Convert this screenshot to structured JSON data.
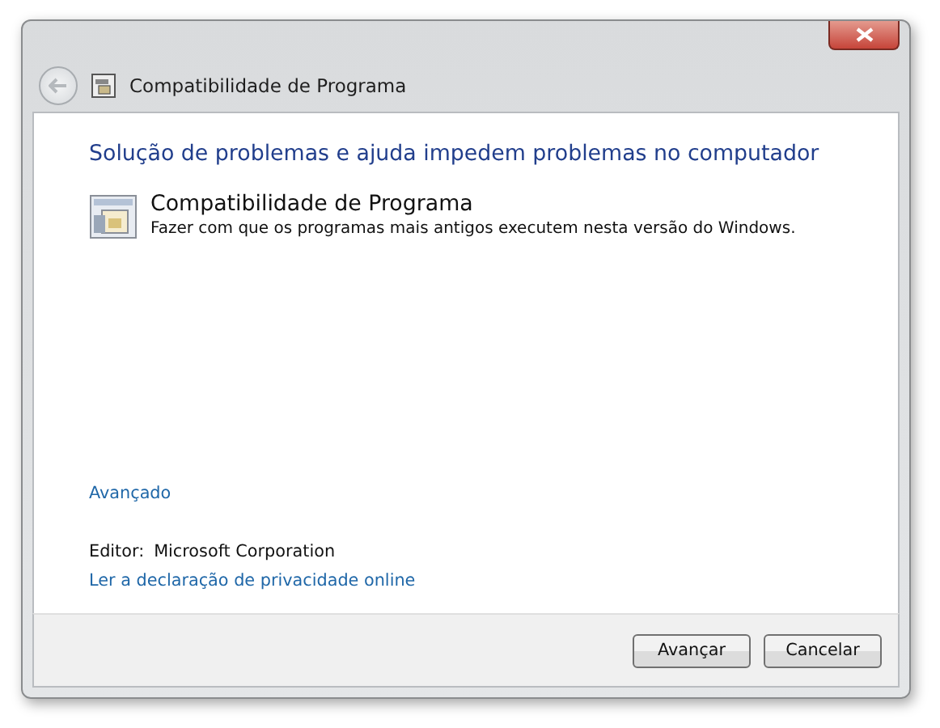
{
  "window": {
    "title": "Compatibilidade de Programa"
  },
  "heading": "Solução de problemas e ajuda impedem problemas no computador",
  "item": {
    "title": "Compatibilidade de Programa",
    "description": "Fazer com que os programas mais antigos executem nesta versão do Windows."
  },
  "advanced_link": "Avançado",
  "publisher": {
    "label": "Editor:",
    "value": "Microsoft Corporation"
  },
  "privacy_link": "Ler a declaração de privacidade online",
  "buttons": [
    {
      "label": "Avançar"
    },
    {
      "label": "Cancelar"
    }
  ]
}
